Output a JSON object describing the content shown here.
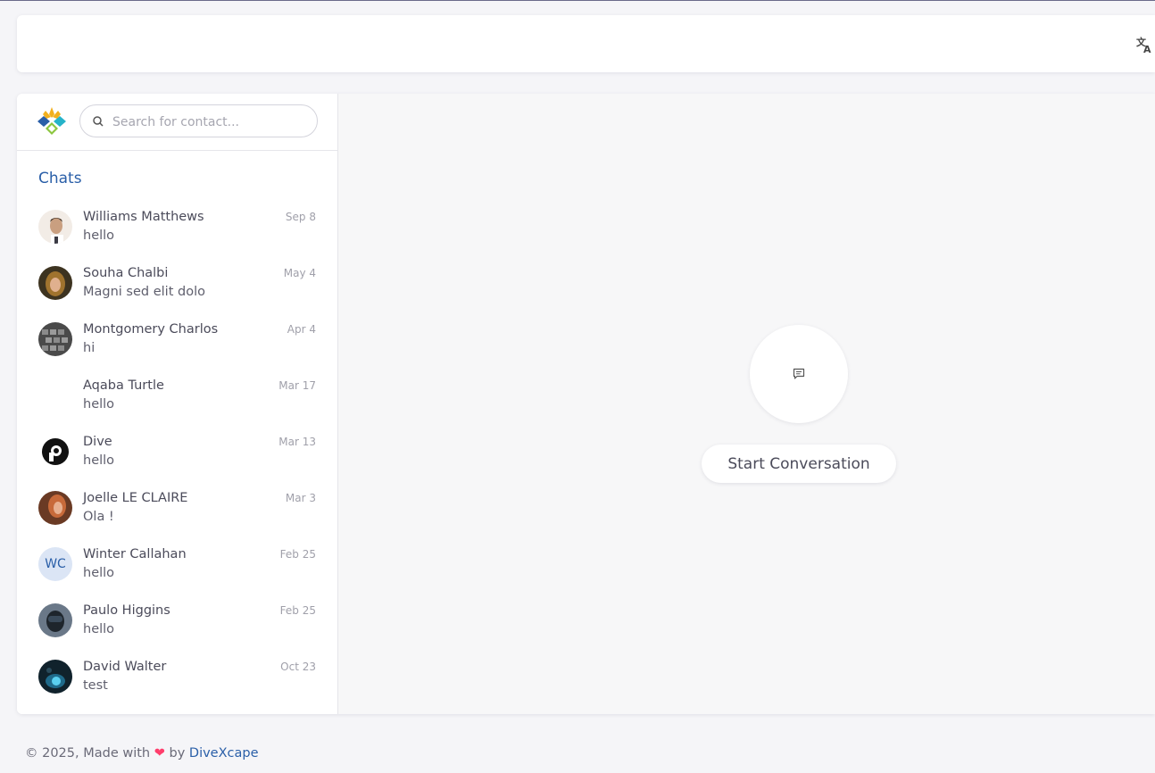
{
  "header": {
    "translate_icon": "translate-icon"
  },
  "sidebar": {
    "logo_icon": "divexcape-logo",
    "search": {
      "placeholder": "Search for contact...",
      "value": ""
    },
    "title": "Chats",
    "chats": [
      {
        "name": "Williams Matthews",
        "preview": "hello",
        "date": "Sep 8",
        "avatar_color": "#d9c9b9"
      },
      {
        "name": "Souha Chalbi",
        "preview": "Magni sed elit dolo",
        "date": "May 4",
        "avatar_color": "#7a5a30"
      },
      {
        "name": "Montgomery Charlos",
        "preview": "hi",
        "date": "Apr 4",
        "avatar_color": "#5a5a5a"
      },
      {
        "name": "Aqaba Turtle",
        "preview": "hello",
        "date": "Mar 17",
        "avatar_color": "#ffffff"
      },
      {
        "name": "Dive",
        "preview": "hello",
        "date": "Mar 13",
        "avatar_color": "#111111"
      },
      {
        "name": "Joelle LE CLAIRE",
        "preview": "Ola !",
        "date": "Mar 3",
        "avatar_color": "#b86a3f"
      },
      {
        "name": "Winter Callahan",
        "preview": "hello",
        "date": "Feb 25",
        "initials": "WC",
        "avatar_color": "#dbe5f5"
      },
      {
        "name": "Paulo Higgins",
        "preview": "hello",
        "date": "Feb 25",
        "avatar_color": "#4a5a6a"
      },
      {
        "name": "David Walter",
        "preview": "test",
        "date": "Oct 23",
        "avatar_color": "#1a3a4a"
      }
    ]
  },
  "main": {
    "start_icon": "message-icon",
    "start_label": "Start Conversation"
  },
  "footer": {
    "prefix": "© 2025, Made with",
    "heart": "❤",
    "by": "by",
    "brand": "DiveXcape"
  },
  "colors": {
    "accent": "#2a5fa8",
    "heart": "#ff3e6c"
  }
}
